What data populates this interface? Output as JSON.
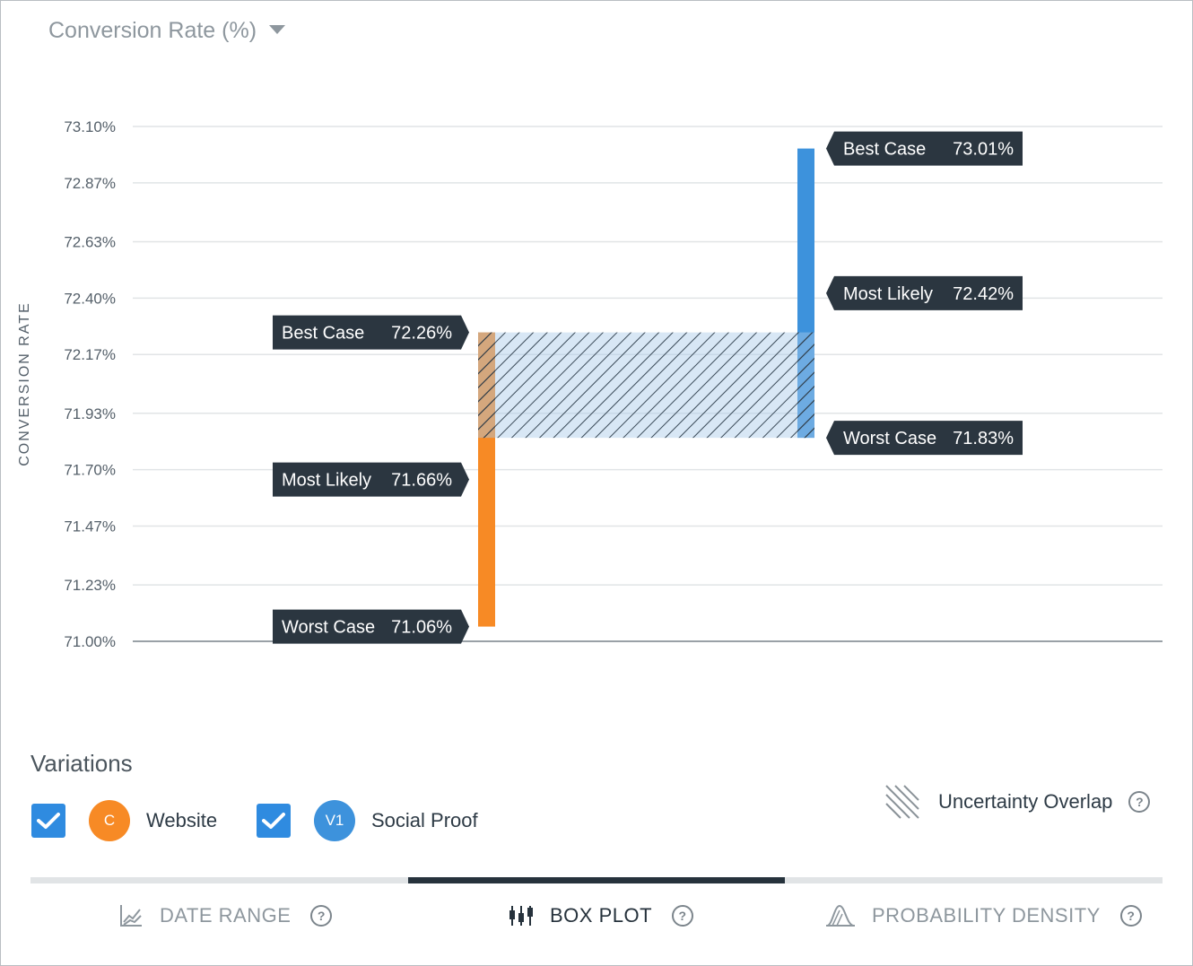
{
  "metric_selector": {
    "label": "Conversion Rate (%)"
  },
  "chart_data": {
    "type": "box",
    "ylabel": "CONVERSION RATE",
    "ylim": [
      71.0,
      73.1
    ],
    "y_ticks": [
      "73.10%",
      "72.87%",
      "72.63%",
      "72.40%",
      "72.17%",
      "71.93%",
      "71.70%",
      "71.47%",
      "71.23%",
      "71.00%"
    ],
    "y_tick_values": [
      73.1,
      72.87,
      72.63,
      72.4,
      72.17,
      71.93,
      71.7,
      71.47,
      71.23,
      71.0
    ],
    "series": [
      {
        "name": "Website",
        "color": "#f78a25",
        "best_case": 72.26,
        "most_likely": 71.66,
        "worst_case": 71.06,
        "labels": {
          "best": "Best Case",
          "most": "Most Likely",
          "worst": "Worst Case"
        },
        "values_text": {
          "best": "72.26%",
          "most": "71.66%",
          "worst": "71.06%"
        },
        "label_side": "left"
      },
      {
        "name": "Social Proof",
        "color": "#3d92dc",
        "best_case": 73.01,
        "most_likely": 72.42,
        "worst_case": 71.83,
        "labels": {
          "best": "Best Case",
          "most": "Most Likely",
          "worst": "Worst Case"
        },
        "values_text": {
          "best": "73.01%",
          "most": "72.42%",
          "worst": "71.83%"
        },
        "label_side": "right"
      }
    ],
    "overlap": {
      "from": 71.83,
      "to": 72.26
    }
  },
  "variations": {
    "title": "Variations",
    "items": [
      {
        "badge": "C",
        "name": "Website",
        "color": "#f78a25",
        "checked": true
      },
      {
        "badge": "V1",
        "name": "Social Proof",
        "color": "#3d92dc",
        "checked": true
      }
    ]
  },
  "legend": {
    "overlap_label": "Uncertainty Overlap"
  },
  "tabs": [
    {
      "label": "DATE RANGE",
      "icon": "line-chart-icon",
      "active": false
    },
    {
      "label": "BOX PLOT",
      "icon": "box-plot-icon",
      "active": true
    },
    {
      "label": "PROBABILITY DENSITY",
      "icon": "density-icon",
      "active": false
    }
  ],
  "help_glyph": "?"
}
